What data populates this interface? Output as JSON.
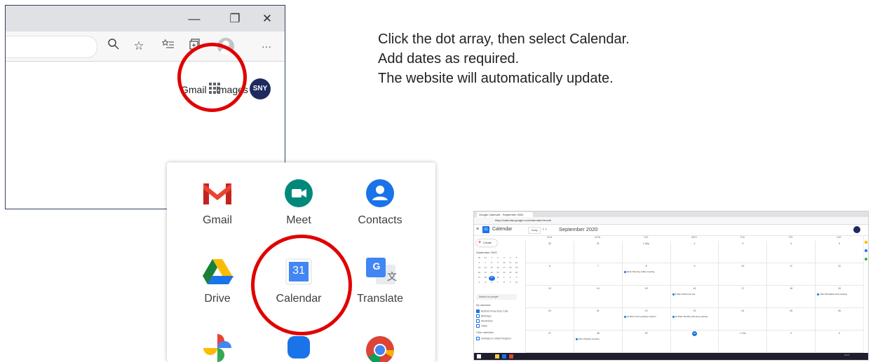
{
  "browser": {
    "window_controls": {
      "minimize": "—",
      "restore": "❐",
      "close": "✕"
    },
    "toolbar_icons": [
      "zoom-icon",
      "favorite-star-icon",
      "favorites-list-icon",
      "collections-icon",
      "profile-icon",
      "more-icon"
    ],
    "more_label": "···",
    "links": {
      "gmail": "Gmail",
      "images": "Images"
    },
    "avatar_text": "SNY"
  },
  "apps": [
    {
      "name": "Gmail",
      "icon": "gmail-icon"
    },
    {
      "name": "Meet",
      "icon": "meet-icon"
    },
    {
      "name": "Contacts",
      "icon": "contacts-icon"
    },
    {
      "name": "Drive",
      "icon": "drive-icon"
    },
    {
      "name": "Calendar",
      "icon": "calendar-icon",
      "badge": "31"
    },
    {
      "name": "Translate",
      "icon": "translate-icon",
      "badge": "G"
    }
  ],
  "instructions": [
    "Click the dot array, then select Calendar.",
    "Add dates as required.",
    "The website will automatically update."
  ],
  "calendar_screenshot": {
    "tab_title": "Google Calendar - September 2020",
    "url": "https://calendar.google.com/calendar/r/month",
    "app_title": "Calendar",
    "logo_number": "31",
    "today_label": "Today",
    "nav_arrows": "‹  ›",
    "month_title": "September 2020",
    "create_label": "Create",
    "mini_month_title": "September 2020",
    "mini_days": [
      "30",
      "31",
      "1",
      "2",
      "3",
      "4",
      "5",
      "6",
      "7",
      "8",
      "9",
      "10",
      "11",
      "12",
      "13",
      "14",
      "15",
      "16",
      "17",
      "18",
      "19",
      "20",
      "21",
      "22",
      "23",
      "24",
      "25",
      "26",
      "27",
      "28",
      "29",
      "30",
      "1",
      "2",
      "3",
      "4",
      "5",
      "6",
      "7",
      "8",
      "9",
      "10"
    ],
    "mini_selected": "29",
    "search_placeholder": "Search for people",
    "my_calendars_label": "My calendars",
    "my_calendars": [
      "Bedford Rural Drop Cafe",
      "Birthdays",
      "Reminders",
      "Tasks"
    ],
    "other_calendars_label": "Other calendars",
    "other_calendars": [
      "Holidays in United Kingdom"
    ],
    "weekdays": [
      "SUN",
      "MON",
      "TUE",
      "WED",
      "THU",
      "FRI",
      "SAT"
    ],
    "weeks": [
      [
        "30",
        "31",
        "1 Sep",
        "2",
        "3",
        "4",
        "5"
      ],
      [
        "6",
        "7",
        "8",
        "9",
        "10",
        "11",
        "12"
      ],
      [
        "13",
        "14",
        "15",
        "16",
        "17",
        "18",
        "19"
      ],
      [
        "20",
        "21",
        "22",
        "23",
        "24",
        "25",
        "26"
      ],
      [
        "27",
        "28",
        "29",
        "30",
        "1 Oct",
        "2",
        "3"
      ]
    ],
    "events": [
      {
        "week": 1,
        "day": 2,
        "text": "10am Morning coffee meeting"
      },
      {
        "week": 2,
        "day": 3,
        "text": "2:30pm Afternoon tea"
      },
      {
        "week": 2,
        "day": 6,
        "text": "10am Breakfast club meeting"
      },
      {
        "week": 3,
        "day": 2,
        "text": "10:30am Group activity session"
      },
      {
        "week": 3,
        "day": 3,
        "text": "11:30am Monthly planning meeting"
      },
      {
        "week": 4,
        "day": 1,
        "text": "10am Weekly meeting"
      }
    ],
    "today_day": "30",
    "clock": "12:17"
  }
}
